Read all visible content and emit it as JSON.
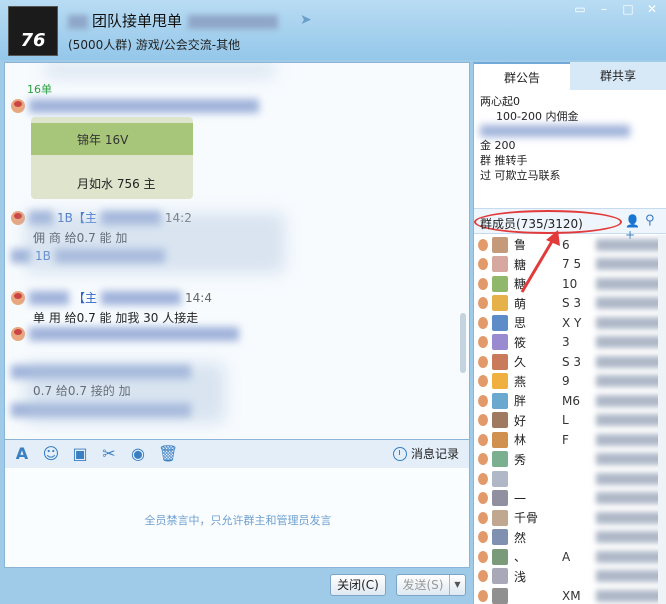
{
  "window": {
    "title": "团队接单甩单",
    "subtitle": "(5000人群) 游戏/公会交流-其他",
    "avatar_text": "76"
  },
  "chat": {
    "note_16": "16单",
    "messages": [
      {
        "sender": "1B【主",
        "time": "14:2",
        "body": "佣  商  给0.7  能  加"
      },
      {
        "sender": "1B",
        "time": "",
        "body": ""
      },
      {
        "sender": "【主",
        "time": "14:4",
        "body": "单  用  给0.7  能  加我  30   人接走"
      },
      {
        "sender": "",
        "time": "",
        "body": "0.7   给0.7   接的  加"
      }
    ],
    "image_card": {
      "line1": "锦年  16V",
      "line2": "月如水  756  主"
    }
  },
  "toolbar": {
    "history_label": "消息记录"
  },
  "input": {
    "hint": "全员禁言中，只允许群主和管理员发言"
  },
  "buttons": {
    "close": "关闭(C)",
    "send": "发送(S)"
  },
  "right_panel": {
    "tabs": [
      "群公告",
      "群共享"
    ],
    "notice_lines": [
      "两心起0",
      "100-200 内佣金",
      "金 200",
      "群 推转手",
      "过 可欺立马联系"
    ],
    "members_label": "群成员(735/3120)",
    "members": [
      "鲁",
      "糖",
      "糖",
      "萌",
      "思",
      "筱",
      "久",
      "燕",
      "胖",
      "好",
      "林",
      "秀",
      "",
      "一",
      "千骨",
      "然",
      "、",
      "浅",
      "",
      "XM"
    ],
    "member_right_fragments": [
      "6",
      "7 5",
      "10",
      "S 3",
      "X Y",
      "3",
      "S 3",
      "9",
      "M6",
      "L",
      "F",
      "",
      "",
      "",
      "",
      "",
      "A",
      "",
      "XM"
    ]
  },
  "colors": {
    "accent": "#3a7fc2",
    "annotation": "#e23a3a",
    "hint": "#6fa0cf"
  }
}
